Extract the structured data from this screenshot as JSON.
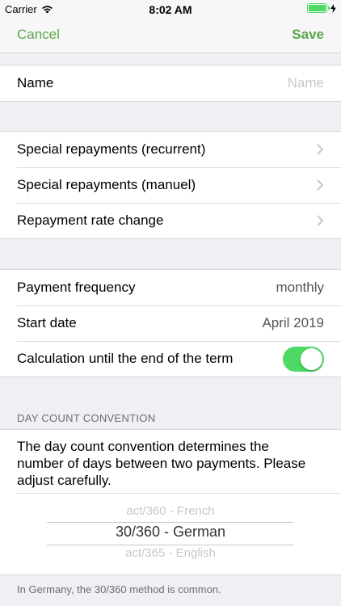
{
  "status": {
    "carrier": "Carrier",
    "time": "8:02 AM"
  },
  "nav": {
    "cancel_label": "Cancel",
    "save_label": "Save"
  },
  "name_row": {
    "label": "Name",
    "placeholder": "Name"
  },
  "repayments": [
    {
      "label": "Special repayments (recurrent)"
    },
    {
      "label": "Special repayments (manuel)"
    },
    {
      "label": "Repayment rate change"
    }
  ],
  "settings": {
    "frequency_label": "Payment frequency",
    "frequency_value": "monthly",
    "start_label": "Start date",
    "start_value": "April 2019",
    "calc_label": "Calculation until the end of the term",
    "calc_enabled": true
  },
  "day_count": {
    "header": "DAY COUNT CONVENTION",
    "description": "The day count convention determines the number of days between two payments. Please adjust carefully.",
    "options": [
      "act/360 - French",
      "30/360 - German",
      "act/365 - English"
    ],
    "selected": "30/360 - German",
    "footer": "In Germany, the 30/360 method is common."
  },
  "colors": {
    "accent": "#59a84a",
    "switch_on": "#4cd964"
  },
  "icons": [
    "wifi-icon",
    "battery-icon",
    "charging-icon",
    "chevron-right-icon"
  ]
}
